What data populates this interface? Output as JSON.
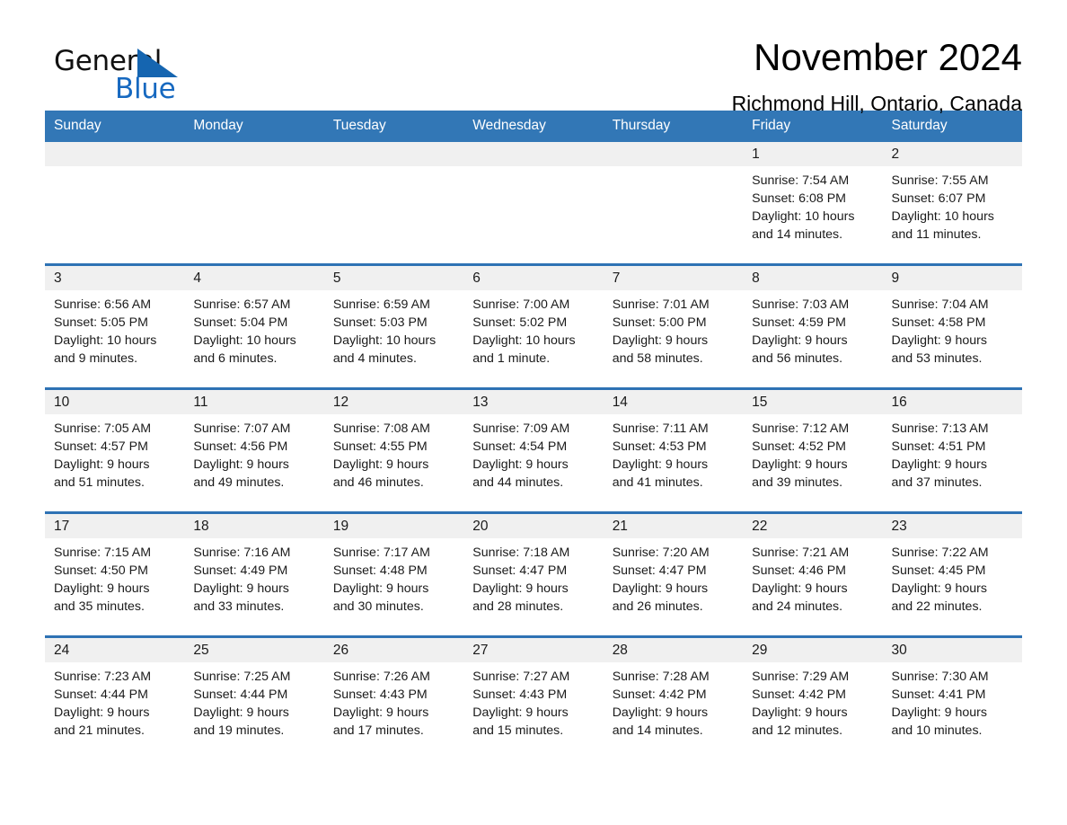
{
  "brand": {
    "name_part1": "General",
    "name_part2": "Blue",
    "triangle_color": "#1565b0",
    "blue_color": "#1769c0"
  },
  "header": {
    "title": "November 2024",
    "location": "Richmond Hill, Ontario, Canada"
  },
  "theme": {
    "header_blue": "#3277b6",
    "divider_blue": "#2e72b4",
    "daynum_bg": "#f0f0f0"
  },
  "weekday_headers": [
    "Sunday",
    "Monday",
    "Tuesday",
    "Wednesday",
    "Thursday",
    "Friday",
    "Saturday"
  ],
  "weeks": [
    [
      {
        "day": "",
        "sunrise": "",
        "sunset": "",
        "daylight1": "",
        "daylight2": ""
      },
      {
        "day": "",
        "sunrise": "",
        "sunset": "",
        "daylight1": "",
        "daylight2": ""
      },
      {
        "day": "",
        "sunrise": "",
        "sunset": "",
        "daylight1": "",
        "daylight2": ""
      },
      {
        "day": "",
        "sunrise": "",
        "sunset": "",
        "daylight1": "",
        "daylight2": ""
      },
      {
        "day": "",
        "sunrise": "",
        "sunset": "",
        "daylight1": "",
        "daylight2": ""
      },
      {
        "day": "1",
        "sunrise": "Sunrise: 7:54 AM",
        "sunset": "Sunset: 6:08 PM",
        "daylight1": "Daylight: 10 hours",
        "daylight2": "and 14 minutes."
      },
      {
        "day": "2",
        "sunrise": "Sunrise: 7:55 AM",
        "sunset": "Sunset: 6:07 PM",
        "daylight1": "Daylight: 10 hours",
        "daylight2": "and 11 minutes."
      }
    ],
    [
      {
        "day": "3",
        "sunrise": "Sunrise: 6:56 AM",
        "sunset": "Sunset: 5:05 PM",
        "daylight1": "Daylight: 10 hours",
        "daylight2": "and 9 minutes."
      },
      {
        "day": "4",
        "sunrise": "Sunrise: 6:57 AM",
        "sunset": "Sunset: 5:04 PM",
        "daylight1": "Daylight: 10 hours",
        "daylight2": "and 6 minutes."
      },
      {
        "day": "5",
        "sunrise": "Sunrise: 6:59 AM",
        "sunset": "Sunset: 5:03 PM",
        "daylight1": "Daylight: 10 hours",
        "daylight2": "and 4 minutes."
      },
      {
        "day": "6",
        "sunrise": "Sunrise: 7:00 AM",
        "sunset": "Sunset: 5:02 PM",
        "daylight1": "Daylight: 10 hours",
        "daylight2": "and 1 minute."
      },
      {
        "day": "7",
        "sunrise": "Sunrise: 7:01 AM",
        "sunset": "Sunset: 5:00 PM",
        "daylight1": "Daylight: 9 hours",
        "daylight2": "and 58 minutes."
      },
      {
        "day": "8",
        "sunrise": "Sunrise: 7:03 AM",
        "sunset": "Sunset: 4:59 PM",
        "daylight1": "Daylight: 9 hours",
        "daylight2": "and 56 minutes."
      },
      {
        "day": "9",
        "sunrise": "Sunrise: 7:04 AM",
        "sunset": "Sunset: 4:58 PM",
        "daylight1": "Daylight: 9 hours",
        "daylight2": "and 53 minutes."
      }
    ],
    [
      {
        "day": "10",
        "sunrise": "Sunrise: 7:05 AM",
        "sunset": "Sunset: 4:57 PM",
        "daylight1": "Daylight: 9 hours",
        "daylight2": "and 51 minutes."
      },
      {
        "day": "11",
        "sunrise": "Sunrise: 7:07 AM",
        "sunset": "Sunset: 4:56 PM",
        "daylight1": "Daylight: 9 hours",
        "daylight2": "and 49 minutes."
      },
      {
        "day": "12",
        "sunrise": "Sunrise: 7:08 AM",
        "sunset": "Sunset: 4:55 PM",
        "daylight1": "Daylight: 9 hours",
        "daylight2": "and 46 minutes."
      },
      {
        "day": "13",
        "sunrise": "Sunrise: 7:09 AM",
        "sunset": "Sunset: 4:54 PM",
        "daylight1": "Daylight: 9 hours",
        "daylight2": "and 44 minutes."
      },
      {
        "day": "14",
        "sunrise": "Sunrise: 7:11 AM",
        "sunset": "Sunset: 4:53 PM",
        "daylight1": "Daylight: 9 hours",
        "daylight2": "and 41 minutes."
      },
      {
        "day": "15",
        "sunrise": "Sunrise: 7:12 AM",
        "sunset": "Sunset: 4:52 PM",
        "daylight1": "Daylight: 9 hours",
        "daylight2": "and 39 minutes."
      },
      {
        "day": "16",
        "sunrise": "Sunrise: 7:13 AM",
        "sunset": "Sunset: 4:51 PM",
        "daylight1": "Daylight: 9 hours",
        "daylight2": "and 37 minutes."
      }
    ],
    [
      {
        "day": "17",
        "sunrise": "Sunrise: 7:15 AM",
        "sunset": "Sunset: 4:50 PM",
        "daylight1": "Daylight: 9 hours",
        "daylight2": "and 35 minutes."
      },
      {
        "day": "18",
        "sunrise": "Sunrise: 7:16 AM",
        "sunset": "Sunset: 4:49 PM",
        "daylight1": "Daylight: 9 hours",
        "daylight2": "and 33 minutes."
      },
      {
        "day": "19",
        "sunrise": "Sunrise: 7:17 AM",
        "sunset": "Sunset: 4:48 PM",
        "daylight1": "Daylight: 9 hours",
        "daylight2": "and 30 minutes."
      },
      {
        "day": "20",
        "sunrise": "Sunrise: 7:18 AM",
        "sunset": "Sunset: 4:47 PM",
        "daylight1": "Daylight: 9 hours",
        "daylight2": "and 28 minutes."
      },
      {
        "day": "21",
        "sunrise": "Sunrise: 7:20 AM",
        "sunset": "Sunset: 4:47 PM",
        "daylight1": "Daylight: 9 hours",
        "daylight2": "and 26 minutes."
      },
      {
        "day": "22",
        "sunrise": "Sunrise: 7:21 AM",
        "sunset": "Sunset: 4:46 PM",
        "daylight1": "Daylight: 9 hours",
        "daylight2": "and 24 minutes."
      },
      {
        "day": "23",
        "sunrise": "Sunrise: 7:22 AM",
        "sunset": "Sunset: 4:45 PM",
        "daylight1": "Daylight: 9 hours",
        "daylight2": "and 22 minutes."
      }
    ],
    [
      {
        "day": "24",
        "sunrise": "Sunrise: 7:23 AM",
        "sunset": "Sunset: 4:44 PM",
        "daylight1": "Daylight: 9 hours",
        "daylight2": "and 21 minutes."
      },
      {
        "day": "25",
        "sunrise": "Sunrise: 7:25 AM",
        "sunset": "Sunset: 4:44 PM",
        "daylight1": "Daylight: 9 hours",
        "daylight2": "and 19 minutes."
      },
      {
        "day": "26",
        "sunrise": "Sunrise: 7:26 AM",
        "sunset": "Sunset: 4:43 PM",
        "daylight1": "Daylight: 9 hours",
        "daylight2": "and 17 minutes."
      },
      {
        "day": "27",
        "sunrise": "Sunrise: 7:27 AM",
        "sunset": "Sunset: 4:43 PM",
        "daylight1": "Daylight: 9 hours",
        "daylight2": "and 15 minutes."
      },
      {
        "day": "28",
        "sunrise": "Sunrise: 7:28 AM",
        "sunset": "Sunset: 4:42 PM",
        "daylight1": "Daylight: 9 hours",
        "daylight2": "and 14 minutes."
      },
      {
        "day": "29",
        "sunrise": "Sunrise: 7:29 AM",
        "sunset": "Sunset: 4:42 PM",
        "daylight1": "Daylight: 9 hours",
        "daylight2": "and 12 minutes."
      },
      {
        "day": "30",
        "sunrise": "Sunrise: 7:30 AM",
        "sunset": "Sunset: 4:41 PM",
        "daylight1": "Daylight: 9 hours",
        "daylight2": "and 10 minutes."
      }
    ]
  ]
}
